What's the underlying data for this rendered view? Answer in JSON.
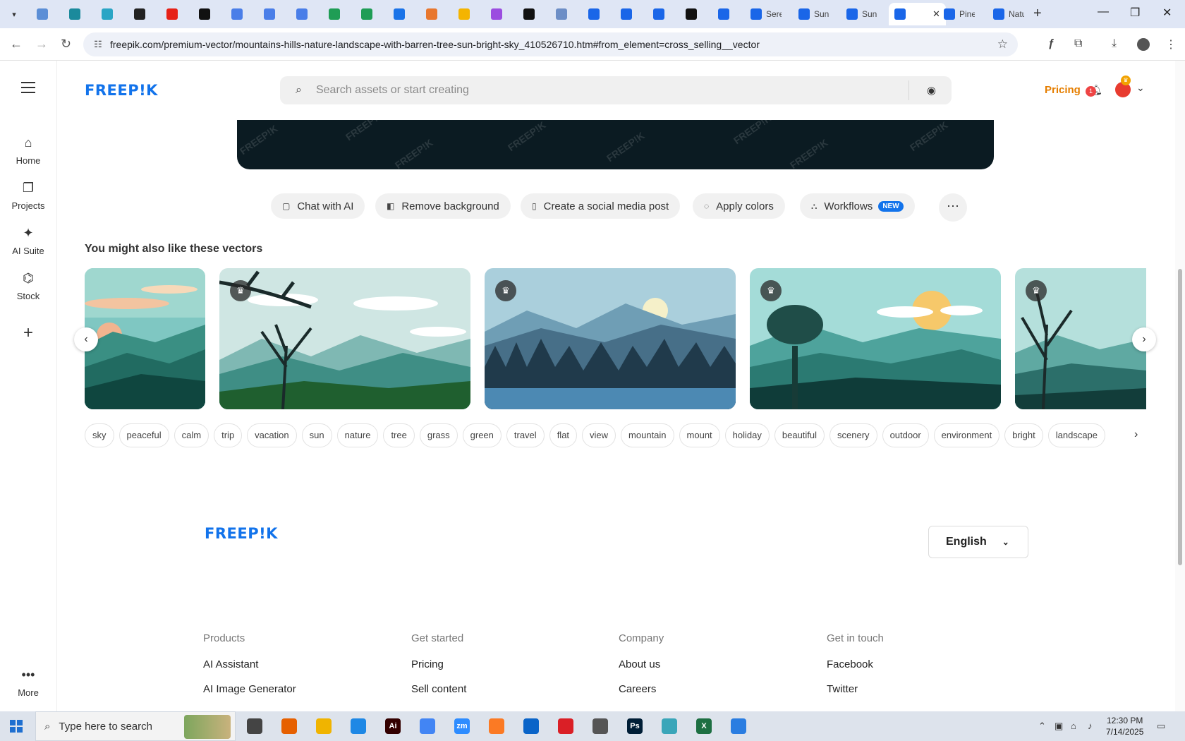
{
  "browser": {
    "tabs": [
      {
        "title": "",
        "color": "#5b8ed6"
      },
      {
        "title": "",
        "color": "#1b8a9c"
      },
      {
        "title": "",
        "color": "#2aa5c5"
      },
      {
        "title": "",
        "color": "#222222"
      },
      {
        "title": "",
        "color": "#e62117"
      },
      {
        "title": "",
        "color": "#111111"
      },
      {
        "title": "",
        "color": "#4a7ee8"
      },
      {
        "title": "",
        "color": "#4a7ee8"
      },
      {
        "title": "",
        "color": "#4a7ee8"
      },
      {
        "title": "",
        "color": "#1f9d55"
      },
      {
        "title": "",
        "color": "#1f9d55"
      },
      {
        "title": "",
        "color": "#1a73e8"
      },
      {
        "title": "",
        "color": "#e8772e"
      },
      {
        "title": "",
        "color": "#f4b400"
      },
      {
        "title": "",
        "color": "#9b4de0"
      },
      {
        "title": "",
        "color": "#111111"
      },
      {
        "title": "",
        "color": "#6d8ec6"
      },
      {
        "title": "",
        "color": "#1a66e8"
      },
      {
        "title": "",
        "color": "#1a66e8"
      },
      {
        "title": "",
        "color": "#1a66e8"
      },
      {
        "title": "",
        "color": "#111111"
      },
      {
        "title": "",
        "color": "#1a66e8"
      },
      {
        "title": "Sere",
        "color": "#1a66e8"
      },
      {
        "title": "Sun",
        "color": "#1a66e8"
      },
      {
        "title": "Sun",
        "color": "#1a66e8"
      },
      {
        "title": "",
        "color": "#1a66e8"
      },
      {
        "title": "Pine",
        "color": "#1a66e8"
      },
      {
        "title": "Natu",
        "color": "#1a66e8"
      }
    ],
    "url": "freepik.com/premium-vector/mountains-hills-nature-landscape-with-barren-tree-sun-bright-sky_410526710.htm#from_element=cross_selling__vector"
  },
  "sidebar": {
    "items": [
      {
        "label": "Home",
        "icon": "home-icon"
      },
      {
        "label": "Projects",
        "icon": "projects-icon"
      },
      {
        "label": "AI Suite",
        "icon": "sparkle-icon"
      },
      {
        "label": "Stock",
        "icon": "stock-icon"
      }
    ],
    "more_label": "More"
  },
  "header": {
    "logo": "FREEP!K",
    "search_placeholder": "Search assets or start creating",
    "pricing": "Pricing",
    "notifications": "1"
  },
  "actions": [
    {
      "label": "Chat with AI",
      "icon": "chat-icon"
    },
    {
      "label": "Remove background",
      "icon": "remove-bg-icon"
    },
    {
      "label": "Create a social media post",
      "icon": "phone-icon"
    },
    {
      "label": "Apply colors",
      "icon": "palette-icon"
    },
    {
      "label": "Workflows",
      "icon": "workflow-icon",
      "badge": "NEW"
    }
  ],
  "related": {
    "title": "You might also like these vectors",
    "cards": [
      {
        "premium": false
      },
      {
        "premium": true
      },
      {
        "premium": true
      },
      {
        "premium": true
      },
      {
        "premium": true
      }
    ]
  },
  "tags": [
    "sky",
    "peaceful",
    "calm",
    "trip",
    "vacation",
    "sun",
    "nature",
    "tree",
    "grass",
    "green",
    "travel",
    "flat",
    "view",
    "mountain",
    "mount",
    "holiday",
    "beautiful",
    "scenery",
    "outdoor",
    "environment",
    "bright",
    "landscape"
  ],
  "footer": {
    "logo": "FREEP!K",
    "language": "English",
    "columns": [
      {
        "heading": "Products",
        "links": [
          "AI Assistant",
          "AI Image Generator"
        ]
      },
      {
        "heading": "Get started",
        "links": [
          "Pricing",
          "Sell content"
        ]
      },
      {
        "heading": "Company",
        "links": [
          "About us",
          "Careers"
        ]
      },
      {
        "heading": "Get in touch",
        "links": [
          "Facebook",
          "Twitter"
        ]
      }
    ]
  },
  "taskbar": {
    "search_placeholder": "Type here to search",
    "time": "12:30 PM",
    "date": "7/14/2025",
    "apps": [
      {
        "name": "task-view",
        "color": "#444444",
        "label": ""
      },
      {
        "name": "firefox",
        "color": "#e66000",
        "label": ""
      },
      {
        "name": "file-explorer",
        "color": "#f0b400",
        "label": ""
      },
      {
        "name": "vscode",
        "color": "#1e88e5",
        "label": ""
      },
      {
        "name": "illustrator",
        "color": "#330000",
        "label": "Ai"
      },
      {
        "name": "chrome",
        "color": "#4285f4",
        "label": ""
      },
      {
        "name": "zoom",
        "color": "#2d8cff",
        "label": "zm"
      },
      {
        "name": "xampp",
        "color": "#fb7a24",
        "label": ""
      },
      {
        "name": "outlook",
        "color": "#0a64c8",
        "label": ""
      },
      {
        "name": "creative-cloud",
        "color": "#da1f26",
        "label": ""
      },
      {
        "name": "pen-tool",
        "color": "#555555",
        "label": ""
      },
      {
        "name": "photoshop",
        "color": "#001e36",
        "label": "Ps"
      },
      {
        "name": "app",
        "color": "#3aa6b9",
        "label": ""
      },
      {
        "name": "excel",
        "color": "#1d6f42",
        "label": "X"
      },
      {
        "name": "paint",
        "color": "#2a7de1",
        "label": ""
      }
    ]
  }
}
